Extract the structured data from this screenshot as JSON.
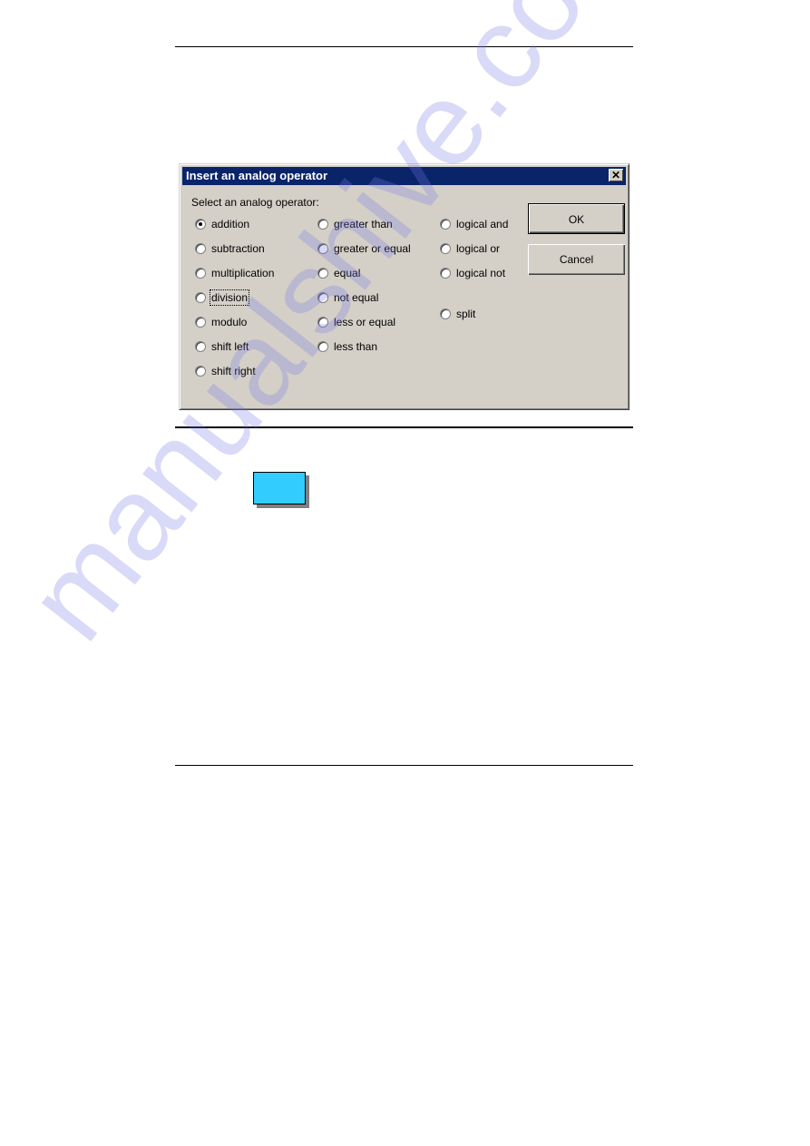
{
  "dialog": {
    "title": "Insert an analog operator",
    "close_glyph": "✕",
    "group_label": "Select an analog operator:",
    "selected": "addition",
    "focused": "division",
    "columns": [
      [
        "addition",
        "subtraction",
        "multiplication",
        "division",
        "modulo",
        "shift left",
        "shift right"
      ],
      [
        "greater than",
        "greater or equal",
        "equal",
        "not equal",
        "less or equal",
        "less than"
      ],
      [
        "logical and",
        "logical or",
        "logical not",
        "split"
      ]
    ],
    "ok_label": "OK",
    "cancel_label": "Cancel"
  },
  "figure": {
    "shape_color": "#33ccff"
  },
  "watermark": "manualshive.com"
}
